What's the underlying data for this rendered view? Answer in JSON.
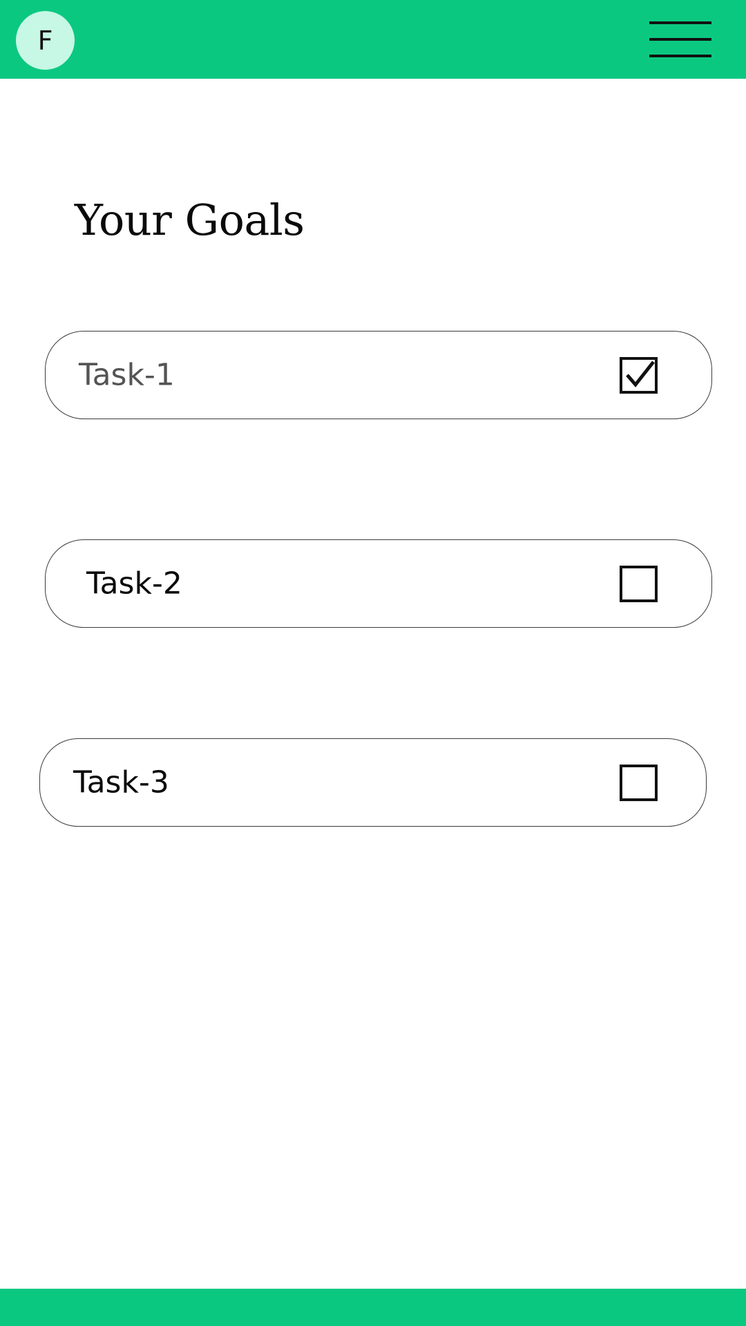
{
  "header": {
    "avatar_initial": "F",
    "menu_icon": "hamburger-menu-icon",
    "bar_color": "#0bc881",
    "avatar_bg": "#c7f7e5"
  },
  "main": {
    "title": "Your Goals",
    "tasks": [
      {
        "label": "Task-1",
        "checked": true
      },
      {
        "label": "Task-2",
        "checked": false
      },
      {
        "label": "Task-3",
        "checked": false
      }
    ]
  },
  "footer": {
    "bar_color": "#0bc881"
  }
}
